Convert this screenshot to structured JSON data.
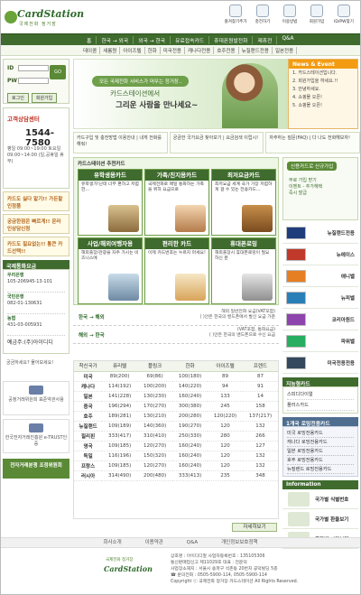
{
  "header": {
    "logo_name": "CardStation",
    "logo_sub": "국제전화 정거장",
    "icons": [
      {
        "name": "bookmark-icon",
        "label": "즐겨찾기추가"
      },
      {
        "name": "charge-icon",
        "label": "충전하기"
      },
      {
        "name": "usage-icon",
        "label": "이용방법"
      },
      {
        "name": "signup-icon",
        "label": "회원가입"
      },
      {
        "name": "idpw-icon",
        "label": "ID/PW찾기"
      }
    ]
  },
  "nav": [
    "홈",
    "한국 → 외국",
    "외국 → 한국",
    "유료접속카드",
    "휴대폰원발전화",
    "제휴전",
    "Q&A"
  ],
  "subnav": [
    "데이콤",
    "새롬원",
    "아이즈텔",
    "한화",
    "미국전용",
    "캐나다전용",
    "호주전용",
    "뉴질랜드전용",
    "일본전용"
  ],
  "login": {
    "id_label": "ID",
    "pw_label": "PW",
    "go_label": "GO",
    "login_button": "로그인",
    "signup_button": "회원가입"
  },
  "support": {
    "title": "고객상담센터",
    "tel": "1544-7580",
    "hours": "평일 09:00~19:00 토요일 09:00~14:00 (일,공휴일 휴무)"
  },
  "promos": [
    "카드도 싫다 맡기!! 가든할인정품",
    "궁금한점은 빠르게!! 온라인상담신청",
    "카드도 필요없는!! 통큰 카드선택!!"
  ],
  "rate_box": {
    "title": "국제통화요금",
    "items": [
      {
        "name": "우리은행",
        "acct": "105-206945-13-101"
      },
      {
        "name": "국민은행",
        "acct": "082-01-130631"
      },
      {
        "name": "농협",
        "acct": "431-03-005931"
      }
    ],
    "footer_note": "예금주:(주)아이디디"
  },
  "qa_circle": "궁금하세요? 물어보세요!",
  "seals": [
    "공정거래위원회 표준약관사용",
    "한국전자거래진흥원 e-TRUST인증"
  ],
  "chart_btn": "전자거래분쟁 조정위원회",
  "hero": {
    "tag": "모든 국제전화 서비스가 머무는 정거장..",
    "line1": "카드스테이션에서",
    "line2": "그리운 사람을 만나세요~"
  },
  "news": {
    "title": "News & Event",
    "items": [
      "1. 카드스테이션입니다.",
      "2. 회원가입을 하세요.!!",
      "3. 안녕하세요.",
      "4. 쇼핑몰 오픈!",
      "5. 쇼핑몰 오픈!"
    ]
  },
  "banners": [
    "카드구입 및 충전방법 이용안내 | 내게 전화를 해줘!",
    "궁금한 국가요금 찾아보기 | 요금검색 이럽시!",
    "자주하는 질문(FAQ) | 다 나도 전화해보자!"
  ],
  "cards": {
    "title": "카드스테이션 추천카드",
    "items": [
      {
        "title": "유학생용카드",
        "desc": "유학생가!난데 너무 편하고 저렴한..."
      },
      {
        "title": "가족/친지용카드",
        "desc": "국제전화로 매일 통화하는 가족을 위하 요금으로"
      },
      {
        "title": "최저요금카드",
        "desc": "최저요금 세계 국가 가장 저렴하게 걸 수 있는 전용카드..."
      },
      {
        "title": "사업/해외여행자용",
        "desc": "해외출장/관광을 자주 가시는 비즈니스에"
      },
      {
        "title": "편리한 카드",
        "desc": "이제 카드번호는 누르지 마세요!"
      },
      {
        "title": "휴대폰로밍",
        "desc": "해외출장시 휴대폰로밍이 필요하신 분"
      }
    ]
  },
  "phone_ad": {
    "title": "신용카드로 신규가입",
    "lines": [
      "신용카드로 신규가입",
      "무로 가입 받기",
      "이벤트 - 추가혜택",
      "즉시 발급"
    ]
  },
  "countries": [
    "뉴질랜드전용",
    "뉴에이스",
    "애니벨",
    "뉴피벨",
    "코리아원드",
    "파워벨",
    "미국전용전용"
  ],
  "tools": {
    "title": "지능형카드",
    "items": [
      "스피디다이얼",
      "플러스카드"
    ]
  },
  "special": {
    "title": "1개국 로밍전용카드",
    "items": [
      "미국 로밍전용카드",
      "캐나다 로밍전용카드",
      "일본 로밍전용카드",
      "호주 로밍전용카드",
      "뉴질랜드 로밍전용카드"
    ]
  },
  "information": {
    "title": "Information",
    "items": [
      "국가별 식별번호",
      "국가별 환율보기",
      "국가별 시차보기"
    ]
  },
  "rates": {
    "korea_to_world": "한국 → 해외",
    "world_to_korea": "해외 → 한국",
    "note1": "해외 일반전화 요금(VAT포함)",
    "note2": "( )안은 한국의 밴드폰에서 발신 요금 가준",
    "note3": "(VAT포함, 통화요금)",
    "note4": "( )안은 한국의 밴드폰으로 수신 요금"
  },
  "table": {
    "headers": [
      "착신국가",
      "퓨리텔",
      "플링크",
      "한화",
      "아이즈텔",
      "프렌드"
    ],
    "rows": [
      [
        "미국",
        "89(200)",
        "69(86)",
        "100(180)",
        "89",
        "87"
      ],
      [
        "캐나다",
        "114(192)",
        "100(200)",
        "140(220)",
        "94",
        "91"
      ],
      [
        "일본",
        "141(228)",
        "130(230)",
        "160(240)",
        "133",
        "14"
      ],
      [
        "중국",
        "196(294)",
        "170(270)",
        "300(380)",
        "245",
        "158"
      ],
      [
        "호주",
        "189(281)",
        "130(210)",
        "200(280)",
        "120(220)",
        "137(217)"
      ],
      [
        "뉴질랜드",
        "109(189)",
        "140(360)",
        "190(270)",
        "120",
        "132"
      ],
      [
        "필리핀",
        "333(417)",
        "310(410)",
        "250(330)",
        "280",
        "266"
      ],
      [
        "영국",
        "109(185)",
        "120(270)",
        "160(240)",
        "120",
        "127"
      ],
      [
        "독일",
        "116(196)",
        "150(320)",
        "160(240)",
        "120",
        "132"
      ],
      [
        "프랑스",
        "109(185)",
        "120(270)",
        "160(240)",
        "120",
        "132"
      ],
      [
        "러시아",
        "314(490)",
        "200(480)",
        "333(413)",
        "235",
        "348"
      ]
    ],
    "more": "자세히보기"
  },
  "footer": {
    "links": [
      "회사소개",
      "이용약관",
      "Q&A",
      "개인정보보호정책"
    ],
    "logo_sub": "국제전화 정거장",
    "logo_name": "CardStation",
    "address_lines": [
      "상호명 : 아이디디얼   사업자등록번호 : 135105306",
      "통신판매업신고 제11029호 대표 : 전윤덕",
      "사업장소재지 : 서울시 송파구 석촌동 20번지 공덕빌딩 5층",
      "☎ 문의전화 : 0505-5900-114, 0505-5900-114",
      "Copyright ⓒ 국제전화 정거장 카드스테이션 All Rights Reserved."
    ]
  },
  "colors": {
    "brand_green": "#3f6b2e",
    "accent_orange": "#f39c12",
    "highlight_red": "#c0392b"
  }
}
